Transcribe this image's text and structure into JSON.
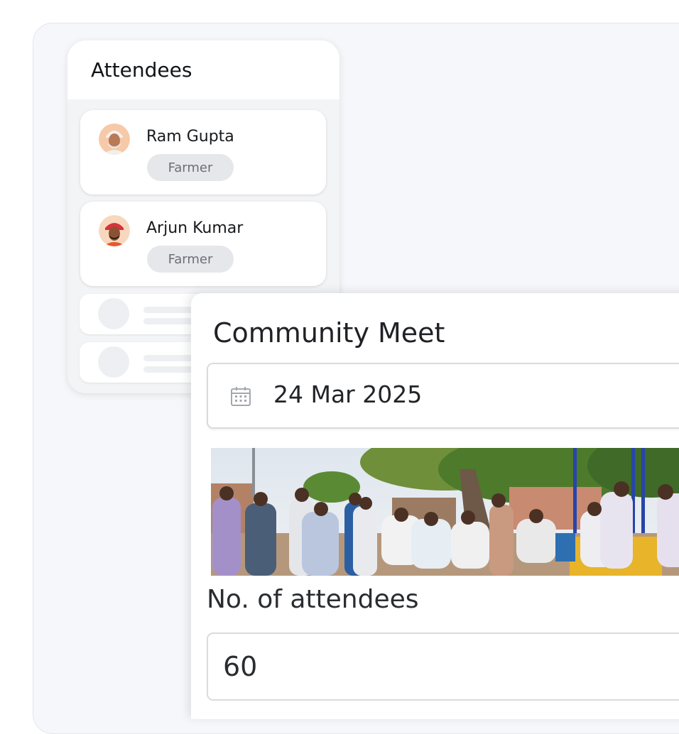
{
  "attendees": {
    "title": "Attendees",
    "items": [
      {
        "name": "Ram Gupta",
        "role": "Farmer"
      },
      {
        "name": "Arjun Kumar",
        "role": "Farmer"
      }
    ]
  },
  "event": {
    "title": "Community Meet",
    "date_icon": "calendar-icon",
    "date": "24 Mar 2025",
    "attendee_count_label": "No. of attendees",
    "attendee_count": "60"
  },
  "colors": {
    "background": "#f6f7fa",
    "card": "#ffffff",
    "pill": "#e5e7eb",
    "border": "#d9dbdf"
  }
}
